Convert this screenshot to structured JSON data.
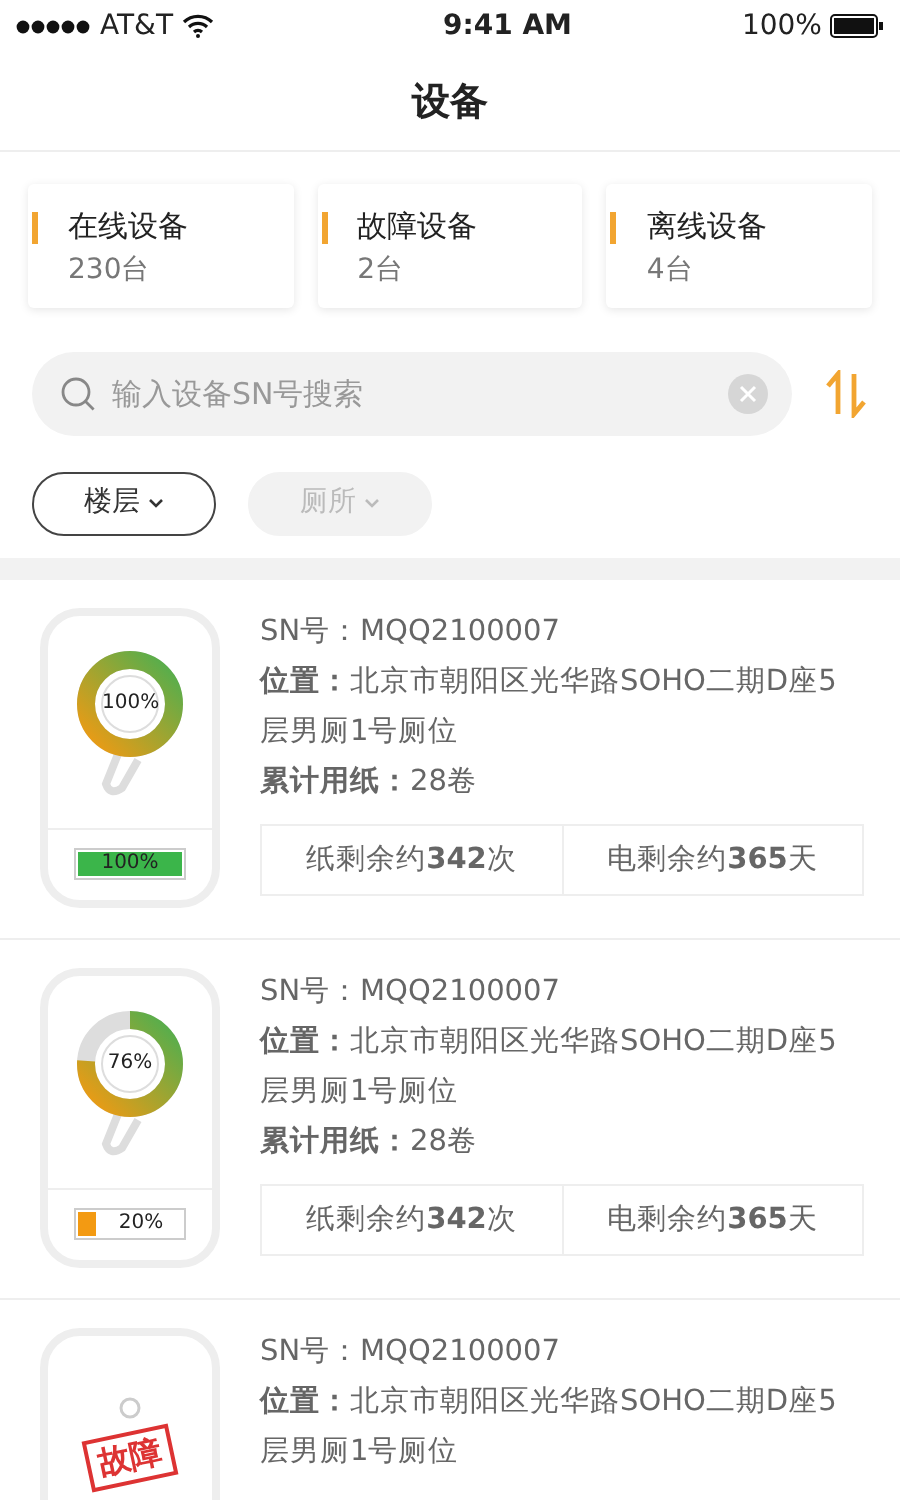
{
  "status_bar": {
    "carrier": "AT&T",
    "time": "9:41 AM",
    "battery": "100%"
  },
  "title": "设备",
  "stats": [
    {
      "label": "在线设备",
      "value": "230台"
    },
    {
      "label": "故障设备",
      "value": "2台"
    },
    {
      "label": "离线设备",
      "value": "4台"
    }
  ],
  "search": {
    "placeholder": "输入设备SN号搜索"
  },
  "filters": [
    {
      "label": "楼层",
      "disabled": false
    },
    {
      "label": "厕所",
      "disabled": true
    }
  ],
  "devices": [
    {
      "kind": "normal",
      "roll": {
        "level": 1.0,
        "reading": "100%"
      },
      "battery": {
        "level": 1.0,
        "reading": "100%"
      },
      "sn": "SN号：MQQ2100007",
      "location": "**位置：**北京市朝阳区光华路SOHO二期D座5层男厕1号厕位",
      "paper": "**累计用纸：**28卷",
      "paper_left": "纸剩余约**342**次",
      "power_left": "电剩余约**365**天"
    },
    {
      "kind": "normal",
      "roll": {
        "level": 0.76,
        "reading": "76%"
      },
      "battery": {
        "level": 0.2,
        "reading": "20%"
      },
      "sn": "SN号：MQQ2100007",
      "location": "**位置：**北京市朝阳区光华路SOHO二期D座5层男厕1号厕位",
      "paper": "**累计用纸：**28卷",
      "paper_left": "纸剩余约**342**次",
      "power_left": "电剩余约**365**天"
    },
    {
      "kind": "fault",
      "stamp": "故障",
      "sn": "SN号：MQQ2100007",
      "location": "**位置：**北京市朝阳区光华路SOHO二期D座5层男厕1号厕位"
    }
  ]
}
